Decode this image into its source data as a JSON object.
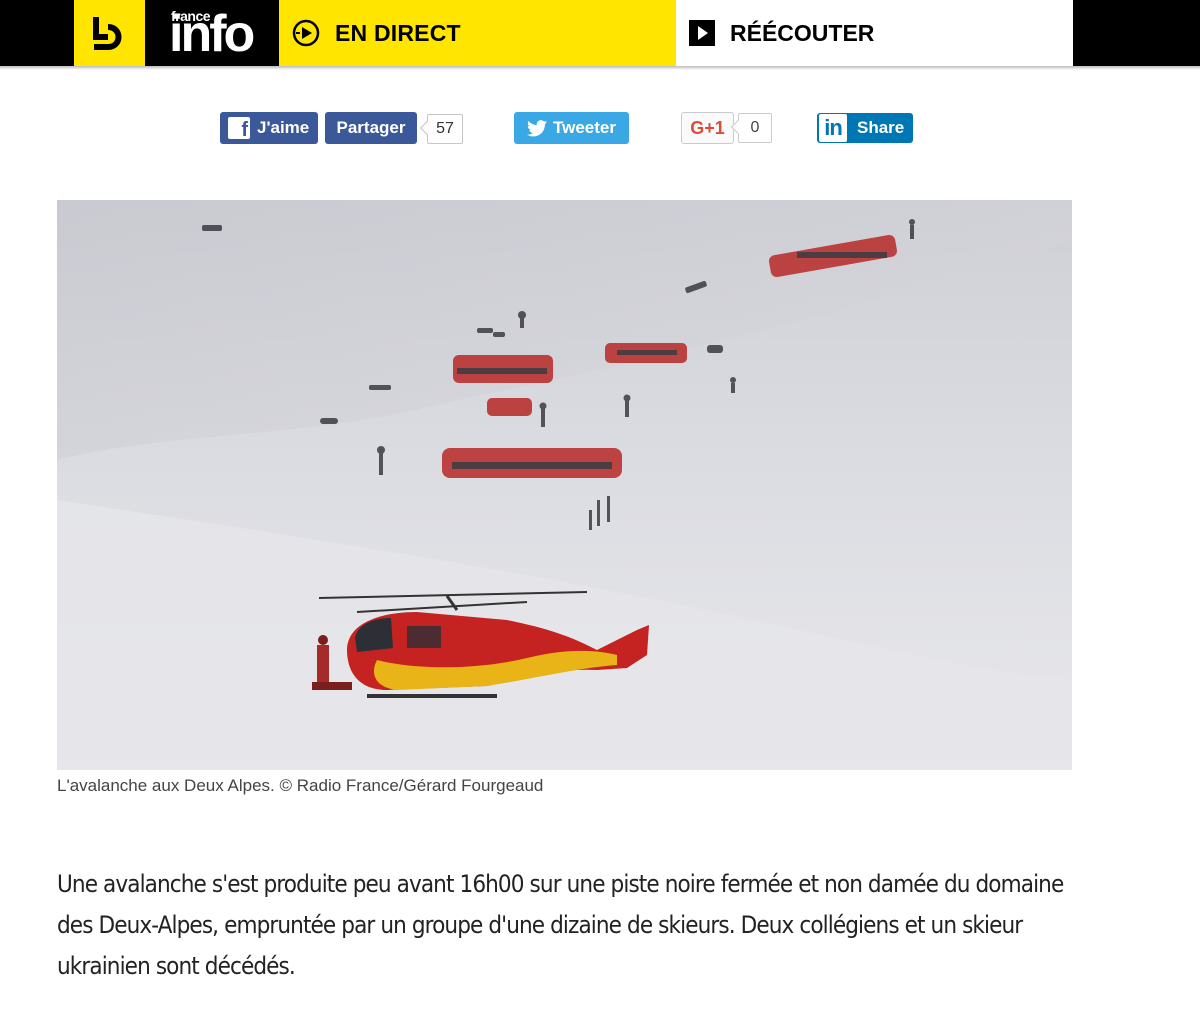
{
  "header": {
    "logo_small": "france",
    "logo_big": "info",
    "live_label": "EN DIRECT",
    "replay_label": "RÉÉCOUTER"
  },
  "share": {
    "facebook_like_label": "J'aime",
    "facebook_share_label": "Partager",
    "facebook_count": "57",
    "tweet_label": "Tweeter",
    "gplus_label": "G+1",
    "gplus_count": "0",
    "linkedin_icon": "in",
    "linkedin_label": "Share"
  },
  "colors": {
    "brand_yellow": "#ffe500",
    "facebook_blue": "#3b5998",
    "twitter_blue": "#3aa8e5",
    "linkedin_blue": "#0077b5",
    "gplus_red": "#dd4b39"
  },
  "figure": {
    "caption": "L'avalanche aux Deux Alpes. © Radio France/Gérard Fourgeaud"
  },
  "article": {
    "paragraph": "Une avalanche s'est produite peu avant 16h00 sur une piste noire fermée et non damée du domaine des Deux-Alpes, empruntée par un groupe d'une dizaine de skieurs. Deux collégiens et un skieur ukrainien sont décédés."
  }
}
